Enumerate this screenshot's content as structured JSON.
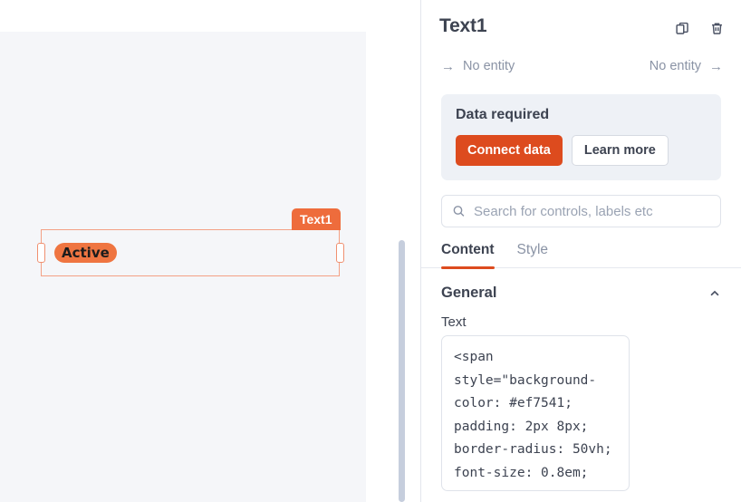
{
  "canvas": {
    "widget_label": "Text1",
    "rendered_text": "Active",
    "pill_color": "#ef7541"
  },
  "panel": {
    "title": "Text1",
    "header_actions": [
      {
        "name": "duplicate-icon",
        "label": "Duplicate"
      },
      {
        "name": "delete-icon",
        "label": "Delete"
      }
    ],
    "entity_nav": {
      "previous_label": "No entity",
      "next_label": "No entity"
    },
    "data_required": {
      "title": "Data required",
      "connect_label": "Connect data",
      "learn_more_label": "Learn more",
      "button_color": "#dd4b1e",
      "background": "#eef1f6"
    },
    "search": {
      "placeholder": "Search for controls, labels etc",
      "value": "",
      "icon": "search-icon"
    },
    "tabs": [
      {
        "label": "Content",
        "active": true
      },
      {
        "label": "Style",
        "active": false
      }
    ],
    "accent_color": "#dd4b1e",
    "sections": [
      {
        "title": "General",
        "expanded": true,
        "chevron": "chevron-up-icon",
        "fields": [
          {
            "label": "Text",
            "value": "<span style=\"background-color: #ef7541; padding: 2px 8px; border-radius: 50vh; font-size: 0.8em; font-family: sans-serif;\">Active</span>"
          }
        ]
      }
    ]
  }
}
